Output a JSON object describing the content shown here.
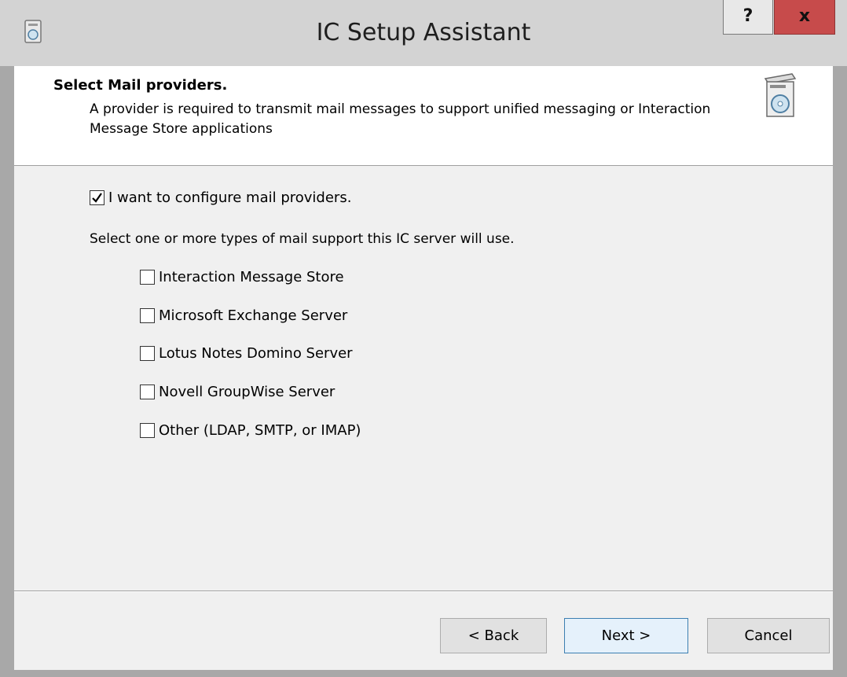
{
  "window": {
    "title": "IC Setup Assistant",
    "help_label": "?",
    "close_label": "x"
  },
  "header": {
    "title": "Select Mail providers.",
    "description": "A provider is required to transmit mail messages to support unified messaging or Interaction Message Store applications"
  },
  "main": {
    "configure_checkbox": {
      "label": "I want to configure mail providers.",
      "checked": true
    },
    "instruction": "Select one or more types of mail support this IC server will use.",
    "providers": [
      {
        "label": "Interaction Message Store",
        "checked": false
      },
      {
        "label": "Microsoft Exchange Server",
        "checked": false
      },
      {
        "label": "Lotus Notes Domino Server",
        "checked": false
      },
      {
        "label": "Novell GroupWise Server",
        "checked": false
      },
      {
        "label": "Other (LDAP, SMTP, or IMAP)",
        "checked": false
      }
    ]
  },
  "buttons": {
    "back": "< Back",
    "next": "Next >",
    "cancel": "Cancel"
  },
  "colors": {
    "close_button": "#c74b4b",
    "default_button_border": "#3c7fb1"
  }
}
